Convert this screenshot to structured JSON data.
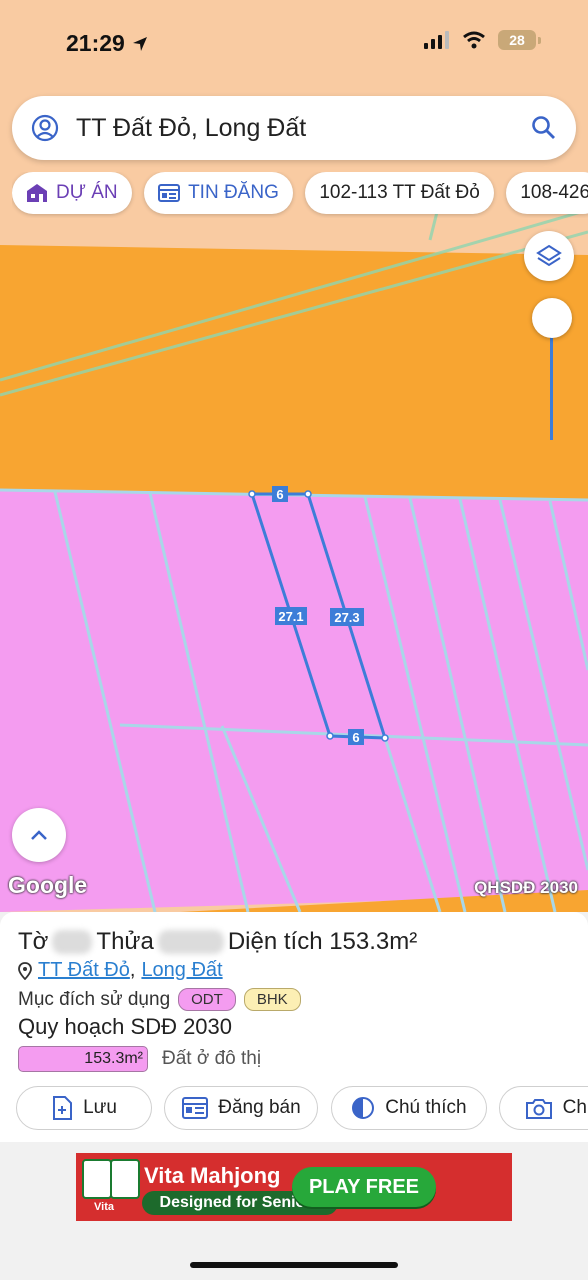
{
  "status_bar": {
    "time": "21:29",
    "battery": "28"
  },
  "search": {
    "query": "TT Đất Đỏ, Long Đất"
  },
  "chips": [
    {
      "label": "DỰ ÁN",
      "icon": "house-icon"
    },
    {
      "label": "TIN ĐĂNG",
      "icon": "listing-icon"
    },
    {
      "label": "102-113 TT Đất Đỏ"
    },
    {
      "label": "108-426"
    }
  ],
  "map": {
    "attribution": "Google",
    "layer_label": "QHSDĐ 2030",
    "edge_labels": {
      "top": "6",
      "left": "27.1",
      "right": "27.3",
      "bottom": "6"
    },
    "colors": {
      "orange_zone": "#f8a531",
      "pink_zone": "#f49cf0",
      "peach_zone": "#f9cba2",
      "boundary": "#3d7dd8"
    }
  },
  "parcel": {
    "to_label": "Tờ",
    "thua_label": "Thửa",
    "area_label": "Diện tích 153.3m²",
    "location_1": "TT Đất Đỏ",
    "location_sep": ",",
    "location_2": "Long Đất",
    "usage_label": "Mục đích sử dụng",
    "usage_tags": [
      "ODT",
      "BHK"
    ],
    "plan_label": "Quy hoạch SDĐ 2030",
    "plan_area": "153.3m²",
    "plan_type": "Đất ở đô thị"
  },
  "actions": [
    {
      "label": "Lưu",
      "icon": "save-plus-icon"
    },
    {
      "label": "Đăng bán",
      "icon": "post-listing-icon"
    },
    {
      "label": "Chú thích",
      "icon": "legend-contrast-icon"
    },
    {
      "label": "Chụp",
      "icon": "camera-icon"
    }
  ],
  "ad": {
    "title": "Vita Mahjong",
    "subtitle": "Designed for Seniors",
    "cta": "PLAY FREE",
    "brand": "Vita"
  }
}
